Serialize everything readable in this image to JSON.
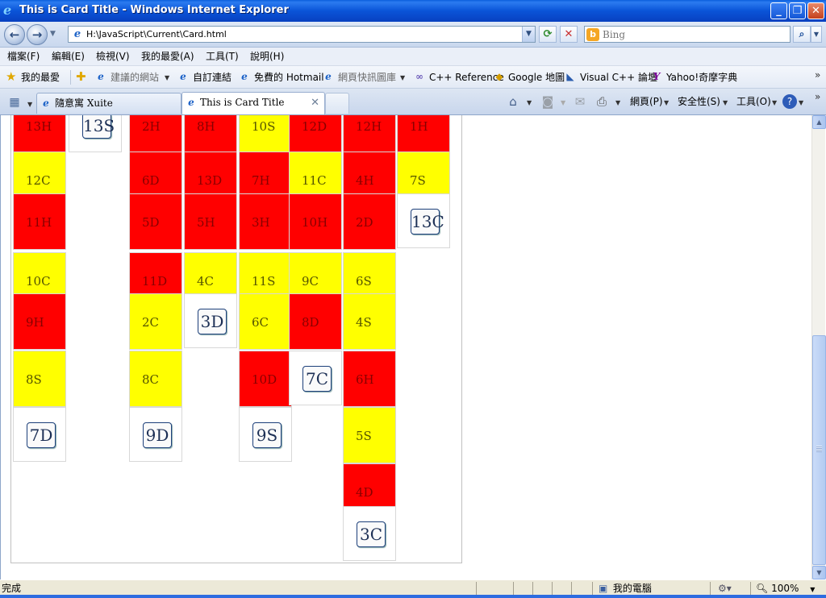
{
  "window": {
    "title": "This is Card Title - Windows Internet Explorer",
    "controls": [
      "minimize",
      "maximize",
      "close"
    ]
  },
  "address": {
    "url": "H:\\JavaScript\\Current\\Card.html",
    "search_placeholder": "Bing"
  },
  "menubar": [
    "檔案(F)",
    "編輯(E)",
    "檢視(V)",
    "我的最愛(A)",
    "工具(T)",
    "說明(H)"
  ],
  "favorites": {
    "label": "我的最愛",
    "items": [
      "建議的網站",
      "自訂連結",
      "免費的 Hotmail",
      "網頁快訊圖庫",
      "C++ Reference",
      "Google 地圖",
      "Visual C++ 論壇",
      "Yahoo!奇摩字典"
    ]
  },
  "tabs": [
    {
      "label": "隨意寓 Xuite",
      "active": false
    },
    {
      "label": "This is Card Title",
      "active": true
    }
  ],
  "command_bar": {
    "page": "網頁(P)",
    "safety": "安全性(S)",
    "tools": "工具(O)"
  },
  "cards": [
    {
      "label": "13H",
      "color": "red",
      "col": 0,
      "row": 0
    },
    {
      "label": "12C",
      "color": "yellow",
      "col": 0,
      "row": 1
    },
    {
      "label": "11H",
      "color": "red",
      "col": 0,
      "row": 2
    },
    {
      "label": "10C",
      "color": "yellow",
      "col": 0,
      "row": 3
    },
    {
      "label": "9H",
      "color": "red",
      "col": 0,
      "row": 4
    },
    {
      "label": "8S",
      "color": "yellow",
      "col": 0,
      "row": 5
    },
    {
      "label": "7D",
      "color": "face",
      "col": 0,
      "row": 6
    },
    {
      "label": "13S",
      "color": "face",
      "col": 1,
      "row": 0
    },
    {
      "label": "2H",
      "color": "red",
      "col": 2,
      "row": 0
    },
    {
      "label": "6D",
      "color": "red",
      "col": 2,
      "row": 1
    },
    {
      "label": "5D",
      "color": "red",
      "col": 2,
      "row": 2
    },
    {
      "label": "11D",
      "color": "red",
      "col": 2,
      "row": 3
    },
    {
      "label": "2C",
      "color": "yellow",
      "col": 2,
      "row": 4
    },
    {
      "label": "8C",
      "color": "yellow",
      "col": 2,
      "row": 5
    },
    {
      "label": "9D",
      "color": "face",
      "col": 2,
      "row": 6
    },
    {
      "label": "8H",
      "color": "red",
      "col": 3,
      "row": 0
    },
    {
      "label": "13D",
      "color": "red",
      "col": 3,
      "row": 1
    },
    {
      "label": "5H",
      "color": "red",
      "col": 3,
      "row": 2
    },
    {
      "label": "4C",
      "color": "yellow",
      "col": 3,
      "row": 3
    },
    {
      "label": "3D",
      "color": "face",
      "col": 3,
      "row": 4
    },
    {
      "label": "10S",
      "color": "yellow",
      "col": 4,
      "row": 0
    },
    {
      "label": "7H",
      "color": "red",
      "col": 4,
      "row": 1
    },
    {
      "label": "3H",
      "color": "red",
      "col": 4,
      "row": 2
    },
    {
      "label": "11S",
      "color": "yellow",
      "col": 4,
      "row": 3
    },
    {
      "label": "6C",
      "color": "yellow",
      "col": 4,
      "row": 4
    },
    {
      "label": "10D",
      "color": "red",
      "col": 4,
      "row": 5
    },
    {
      "label": "9S",
      "color": "face",
      "col": 4,
      "row": 6
    },
    {
      "label": "12D",
      "color": "red",
      "col": 5,
      "row": 0
    },
    {
      "label": "11C",
      "color": "yellow",
      "col": 5,
      "row": 1
    },
    {
      "label": "10H",
      "color": "red",
      "col": 5,
      "row": 2
    },
    {
      "label": "9C",
      "color": "yellow",
      "col": 5,
      "row": 3
    },
    {
      "label": "8D",
      "color": "red",
      "col": 5,
      "row": 4
    },
    {
      "label": "7C",
      "color": "face",
      "col": 5,
      "row": 5
    },
    {
      "label": "12H",
      "color": "red",
      "col": 6,
      "row": 0
    },
    {
      "label": "4H",
      "color": "red",
      "col": 6,
      "row": 1
    },
    {
      "label": "2D",
      "color": "red",
      "col": 6,
      "row": 2
    },
    {
      "label": "6S",
      "color": "yellow",
      "col": 6,
      "row": 3
    },
    {
      "label": "4S",
      "color": "yellow",
      "col": 6,
      "row": 4
    },
    {
      "label": "6H",
      "color": "red",
      "col": 6,
      "row": 5
    },
    {
      "label": "5S",
      "color": "yellow",
      "col": 6,
      "row": 6
    },
    {
      "label": "4D",
      "color": "red",
      "col": 6,
      "row": 7
    },
    {
      "label": "3C",
      "color": "face",
      "col": 6,
      "row": 8
    },
    {
      "label": "1H",
      "color": "red",
      "col": 7,
      "row": 0
    },
    {
      "label": "7S",
      "color": "yellow",
      "col": 7,
      "row": 1
    },
    {
      "label": "13C",
      "color": "face",
      "col": 7,
      "row": 2
    }
  ],
  "status": {
    "text": "完成",
    "zone": "我的電腦",
    "zoom": "100%"
  },
  "colors": {
    "red": "#ff0000",
    "yellow": "#ffff00",
    "title_bar": "#0a54d8"
  }
}
